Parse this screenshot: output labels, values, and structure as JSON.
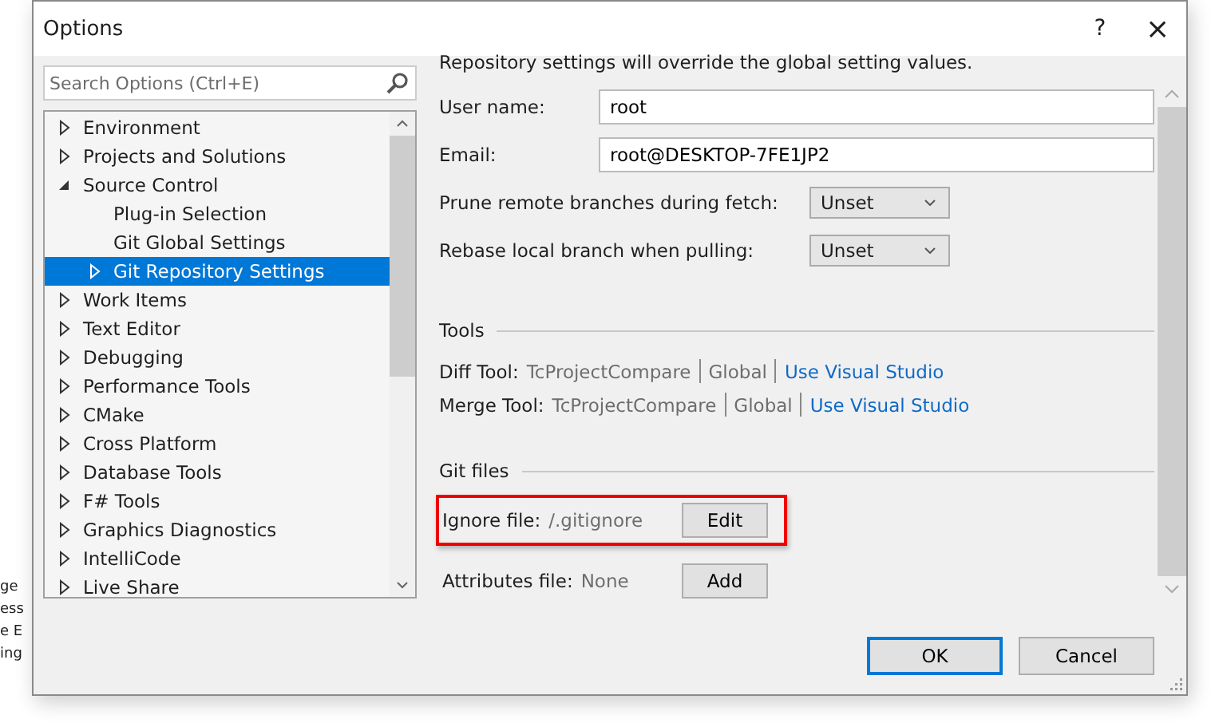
{
  "background_fragments": [
    "ge",
    "ess",
    "e E",
    "ing"
  ],
  "window": {
    "title": "Options",
    "help": "?",
    "close": "×"
  },
  "search": {
    "placeholder": "Search Options (Ctrl+E)"
  },
  "tree": [
    {
      "label": "Environment",
      "expanded": false,
      "selected": false
    },
    {
      "label": "Projects and Solutions",
      "expanded": false,
      "selected": false
    },
    {
      "label": "Source Control",
      "expanded": true,
      "selected": false,
      "children": [
        {
          "label": "Plug-in Selection",
          "selected": false
        },
        {
          "label": "Git Global Settings",
          "selected": false
        },
        {
          "label": "Git Repository Settings",
          "expanded": false,
          "selected": true
        }
      ]
    },
    {
      "label": "Work Items",
      "expanded": false,
      "selected": false
    },
    {
      "label": "Text Editor",
      "expanded": false,
      "selected": false
    },
    {
      "label": "Debugging",
      "expanded": false,
      "selected": false
    },
    {
      "label": "Performance Tools",
      "expanded": false,
      "selected": false
    },
    {
      "label": "CMake",
      "expanded": false,
      "selected": false
    },
    {
      "label": "Cross Platform",
      "expanded": false,
      "selected": false
    },
    {
      "label": "Database Tools",
      "expanded": false,
      "selected": false
    },
    {
      "label": "F# Tools",
      "expanded": false,
      "selected": false
    },
    {
      "label": "Graphics Diagnostics",
      "expanded": false,
      "selected": false
    },
    {
      "label": "IntelliCode",
      "expanded": false,
      "selected": false
    },
    {
      "label": "Live Share",
      "expanded": false,
      "selected": false
    }
  ],
  "settings": {
    "intro": "Repository settings will override the global setting values.",
    "fields": [
      {
        "label": "User name:",
        "value": "root"
      },
      {
        "label": "Email:",
        "value": "root@DESKTOP-7FE1JP2"
      }
    ],
    "dropdowns": [
      {
        "label": "Prune remote branches during fetch:",
        "value": "Unset"
      },
      {
        "label": "Rebase local branch when pulling:",
        "value": "Unset"
      }
    ],
    "tools_heading": "Tools",
    "tools": [
      {
        "label": "Diff Tool:",
        "tool": "TcProjectCompare",
        "scope": "Global",
        "link": "Use Visual Studio"
      },
      {
        "label": "Merge Tool:",
        "tool": "TcProjectCompare",
        "scope": "Global",
        "link": "Use Visual Studio"
      }
    ],
    "git_files_heading": "Git files",
    "git_files": [
      {
        "label": "Ignore file:",
        "value": "/.gitignore",
        "button": "Edit",
        "highlighted": true
      },
      {
        "label": "Attributes file:",
        "value": "None",
        "button": "Add",
        "highlighted": false
      }
    ]
  },
  "buttons": [
    {
      "label": "OK",
      "default": true
    },
    {
      "label": "Cancel",
      "default": false
    }
  ]
}
